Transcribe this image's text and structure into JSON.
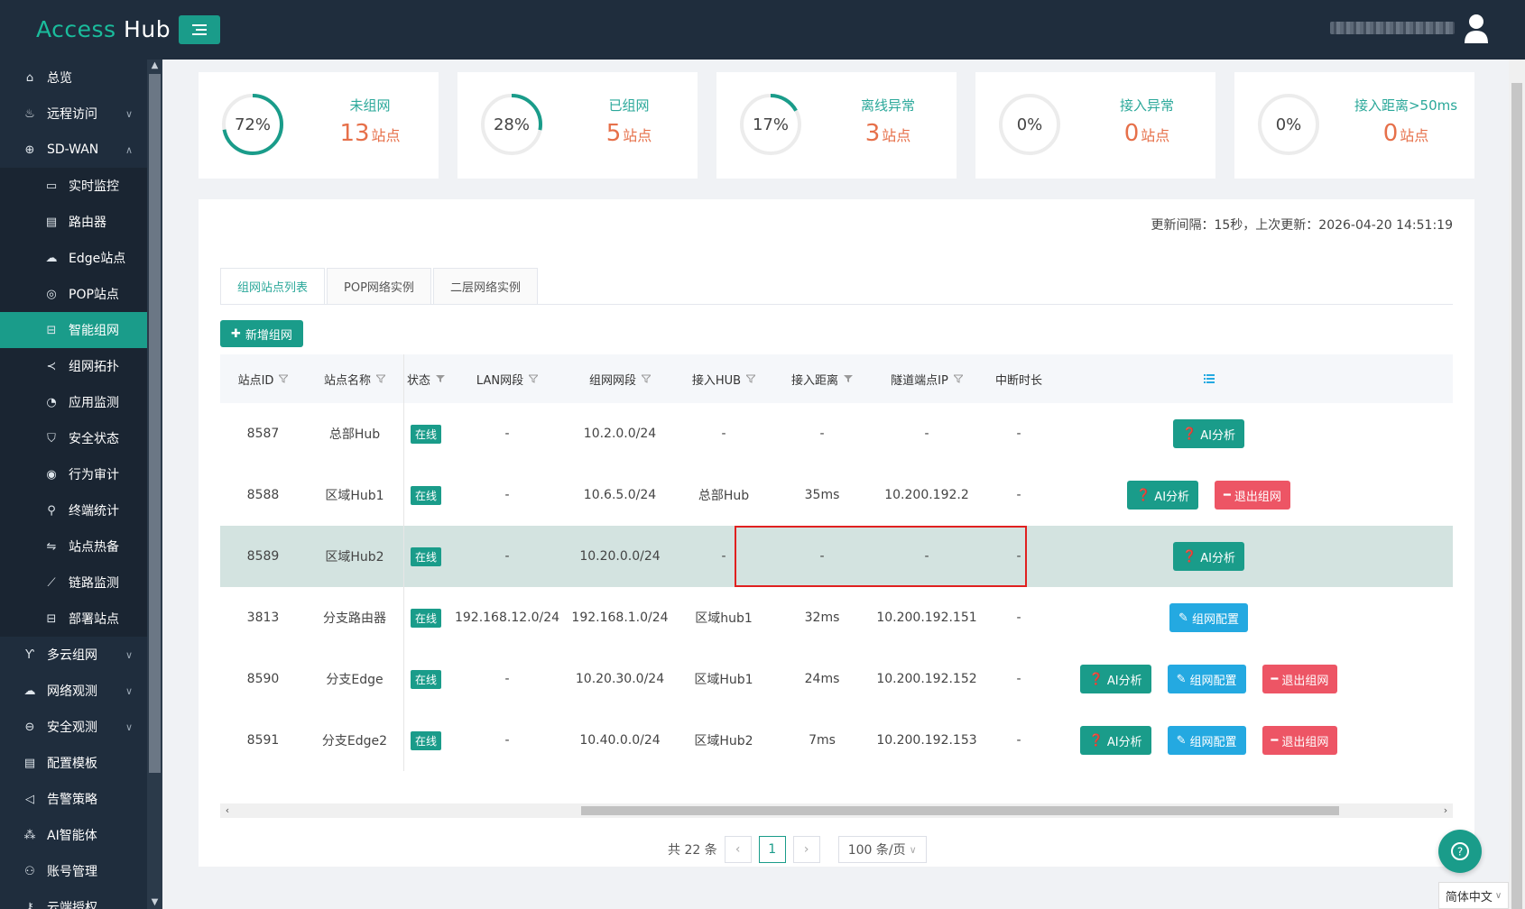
{
  "header": {
    "logo_access": "Access",
    "logo_hub": "Hub"
  },
  "sidebar": {
    "items": [
      {
        "label": "总览",
        "icon": "home-icon"
      },
      {
        "label": "远程访问",
        "icon": "rocket-icon"
      },
      {
        "label": "SD-WAN",
        "icon": "globe-icon"
      }
    ],
    "sub_items": [
      {
        "label": "实时监控",
        "icon": "monitor-icon"
      },
      {
        "label": "路由器",
        "icon": "router-icon"
      },
      {
        "label": "Edge站点",
        "icon": "cloud-icon"
      },
      {
        "label": "POP站点",
        "icon": "location-icon"
      },
      {
        "label": "智能组网",
        "icon": "lock-icon"
      },
      {
        "label": "组网拓扑",
        "icon": "share-icon"
      },
      {
        "label": "应用监测",
        "icon": "pie-icon"
      },
      {
        "label": "安全状态",
        "icon": "shield-icon"
      },
      {
        "label": "行为审计",
        "icon": "eye-icon"
      },
      {
        "label": "终端统计",
        "icon": "search-icon"
      },
      {
        "label": "站点热备",
        "icon": "swap-icon"
      },
      {
        "label": "链路监测",
        "icon": "line-chart-icon"
      },
      {
        "label": "部署站点",
        "icon": "deploy-icon"
      }
    ],
    "bottom_items": [
      {
        "label": "多云组网",
        "icon": "branch-icon"
      },
      {
        "label": "网络观测",
        "icon": "cloud-icon"
      },
      {
        "label": "安全观测",
        "icon": "minus-circle-icon"
      },
      {
        "label": "配置模板",
        "icon": "file-icon"
      },
      {
        "label": "告警策略",
        "icon": "megaphone-icon"
      },
      {
        "label": "AI智能体",
        "icon": "nodes-icon"
      },
      {
        "label": "账号管理",
        "icon": "users-icon"
      },
      {
        "label": "云端授权",
        "icon": "key-icon"
      }
    ]
  },
  "stats": [
    {
      "percent": "72%",
      "ratio": 0.72,
      "title": "未组网",
      "value": "13",
      "unit": "站点"
    },
    {
      "percent": "28%",
      "ratio": 0.28,
      "title": "已组网",
      "value": "5",
      "unit": "站点"
    },
    {
      "percent": "17%",
      "ratio": 0.17,
      "title": "离线异常",
      "value": "3",
      "unit": "站点"
    },
    {
      "percent": "0%",
      "ratio": 0,
      "title": "接入异常",
      "value": "0",
      "unit": "站点"
    },
    {
      "percent": "0%",
      "ratio": 0,
      "title": "接入距离>50ms",
      "value": "0",
      "unit": "站点"
    }
  ],
  "panel": {
    "update_info": "更新间隔：15秒，上次更新：2026-04-20 14:51:19",
    "tabs": [
      "组网站点列表",
      "POP网络实例",
      "二层网络实例"
    ],
    "add_button": "新增组网"
  },
  "table": {
    "columns": [
      "站点ID",
      "站点名称",
      "状态",
      "LAN网段",
      "组网网段",
      "接入HUB",
      "接入距离",
      "隧道端点IP",
      "中断时长"
    ],
    "rows": [
      {
        "id": "8587",
        "name": "总部Hub",
        "status": "在线",
        "lan": "-",
        "net": "10.2.0.0/24",
        "hub": "-",
        "dist": "-",
        "ip": "-",
        "down": "-",
        "actions": [
          "AI分析"
        ]
      },
      {
        "id": "8588",
        "name": "区域Hub1",
        "status": "在线",
        "lan": "-",
        "net": "10.6.5.0/24",
        "hub": "总部Hub",
        "dist": "35ms",
        "ip": "10.200.192.2",
        "down": "-",
        "actions": [
          "AI分析",
          "退出组网"
        ]
      },
      {
        "id": "8589",
        "name": "区域Hub2",
        "status": "在线",
        "lan": "-",
        "net": "10.20.0.0/24",
        "hub": "-",
        "dist": "-",
        "ip": "-",
        "down": "-",
        "actions": [
          "AI分析"
        ]
      },
      {
        "id": "3813",
        "name": "分支路由器",
        "status": "在线",
        "lan": "192.168.12.0/24",
        "net": "192.168.1.0/24",
        "hub": "区域hub1",
        "dist": "32ms",
        "ip": "10.200.192.151",
        "down": "-",
        "actions": [
          "组网配置"
        ]
      },
      {
        "id": "8590",
        "name": "分支Edge",
        "status": "在线",
        "lan": "-",
        "net": "10.20.30.0/24",
        "hub": "区域Hub1",
        "dist": "24ms",
        "ip": "10.200.192.152",
        "down": "-",
        "actions": [
          "AI分析",
          "组网配置",
          "退出组网"
        ]
      },
      {
        "id": "8591",
        "name": "分支Edge2",
        "status": "在线",
        "lan": "-",
        "net": "10.40.0.0/24",
        "hub": "区域Hub2",
        "dist": "7ms",
        "ip": "10.200.192.153",
        "down": "-",
        "actions": [
          "AI分析",
          "组网配置",
          "退出组网"
        ]
      }
    ]
  },
  "pager": {
    "total": "共 22 条",
    "current_page": "1",
    "page_size": "100 条/页"
  },
  "lang": "简体中文",
  "colors": {
    "brand": "#1a9c8a",
    "accent_value": "#e6704a",
    "info_button": "#24a9e1",
    "danger_button": "#ed5565",
    "sidebar_bg": "#1f2d3d"
  }
}
